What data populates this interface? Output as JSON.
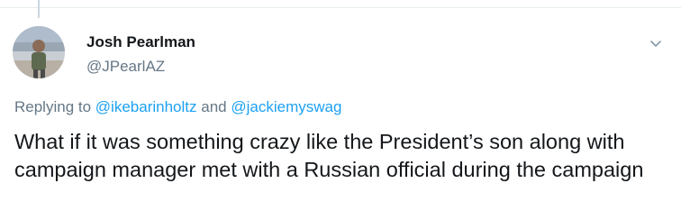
{
  "tweet": {
    "author": {
      "display_name": "Josh Pearlman",
      "handle": "@JPearlAZ",
      "avatar_icon": "profile-photo"
    },
    "menu_icon": "chevron-down-icon",
    "reply": {
      "prefix": "Replying to",
      "mention_1": "@ikebarinholtz",
      "conjunction": "and",
      "mention_2": "@jackiemyswag"
    },
    "text": "What if it was something crazy like the President’s son along with campaign manager met with a Russian official during the campaign"
  },
  "colors": {
    "text_primary": "#14171a",
    "text_secondary": "#657786",
    "link": "#1da1f2",
    "divider": "#e6ecf0",
    "thread_line": "#ccd6dd"
  }
}
